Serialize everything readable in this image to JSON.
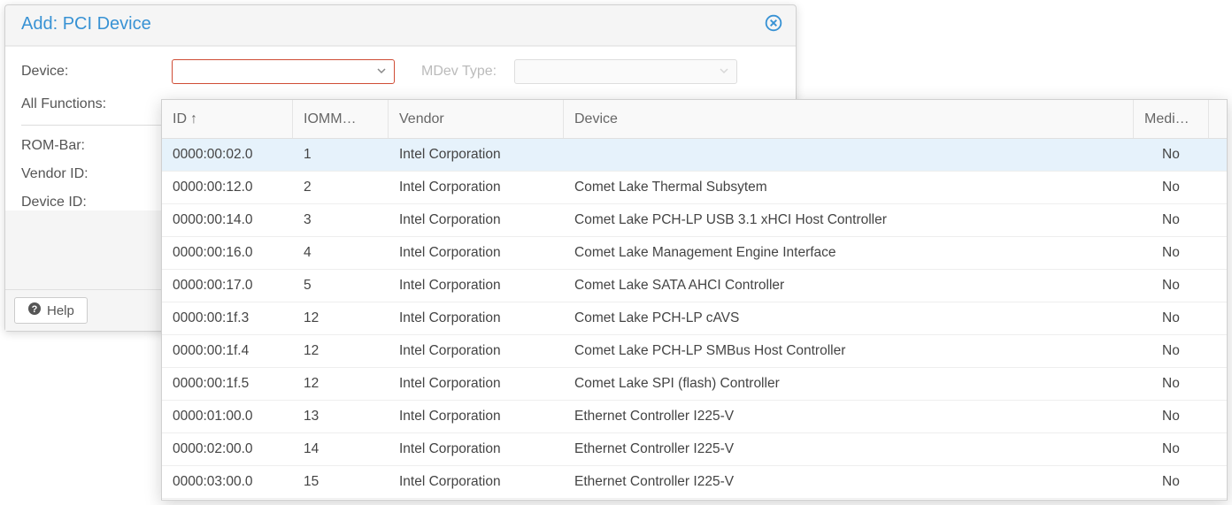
{
  "dialog": {
    "title": "Add: PCI Device",
    "labels": {
      "device": "Device:",
      "mdev_type": "MDev Type:",
      "all_functions": "All Functions:",
      "rom_bar": "ROM-Bar:",
      "vendor_id": "Vendor ID:",
      "device_id": "Device ID:"
    },
    "help_label": "Help"
  },
  "grid": {
    "headers": {
      "id": "ID",
      "iommu": "IOMM…",
      "vendor": "Vendor",
      "device": "Device",
      "med": "Medi…"
    },
    "sort_arrow": "↑",
    "rows": [
      {
        "id": "0000:00:02.0",
        "iommu": "1",
        "vendor": "Intel Corporation",
        "device": "",
        "med": "No",
        "selected": true
      },
      {
        "id": "0000:00:12.0",
        "iommu": "2",
        "vendor": "Intel Corporation",
        "device": "Comet Lake Thermal Subsytem",
        "med": "No"
      },
      {
        "id": "0000:00:14.0",
        "iommu": "3",
        "vendor": "Intel Corporation",
        "device": "Comet Lake PCH-LP USB 3.1 xHCI Host Controller",
        "med": "No"
      },
      {
        "id": "0000:00:16.0",
        "iommu": "4",
        "vendor": "Intel Corporation",
        "device": "Comet Lake Management Engine Interface",
        "med": "No"
      },
      {
        "id": "0000:00:17.0",
        "iommu": "5",
        "vendor": "Intel Corporation",
        "device": "Comet Lake SATA AHCI Controller",
        "med": "No"
      },
      {
        "id": "0000:00:1f.3",
        "iommu": "12",
        "vendor": "Intel Corporation",
        "device": "Comet Lake PCH-LP cAVS",
        "med": "No"
      },
      {
        "id": "0000:00:1f.4",
        "iommu": "12",
        "vendor": "Intel Corporation",
        "device": "Comet Lake PCH-LP SMBus Host Controller",
        "med": "No"
      },
      {
        "id": "0000:00:1f.5",
        "iommu": "12",
        "vendor": "Intel Corporation",
        "device": "Comet Lake SPI (flash) Controller",
        "med": "No"
      },
      {
        "id": "0000:01:00.0",
        "iommu": "13",
        "vendor": "Intel Corporation",
        "device": "Ethernet Controller I225-V",
        "med": "No"
      },
      {
        "id": "0000:02:00.0",
        "iommu": "14",
        "vendor": "Intel Corporation",
        "device": "Ethernet Controller I225-V",
        "med": "No"
      },
      {
        "id": "0000:03:00.0",
        "iommu": "15",
        "vendor": "Intel Corporation",
        "device": "Ethernet Controller I225-V",
        "med": "No"
      }
    ]
  }
}
